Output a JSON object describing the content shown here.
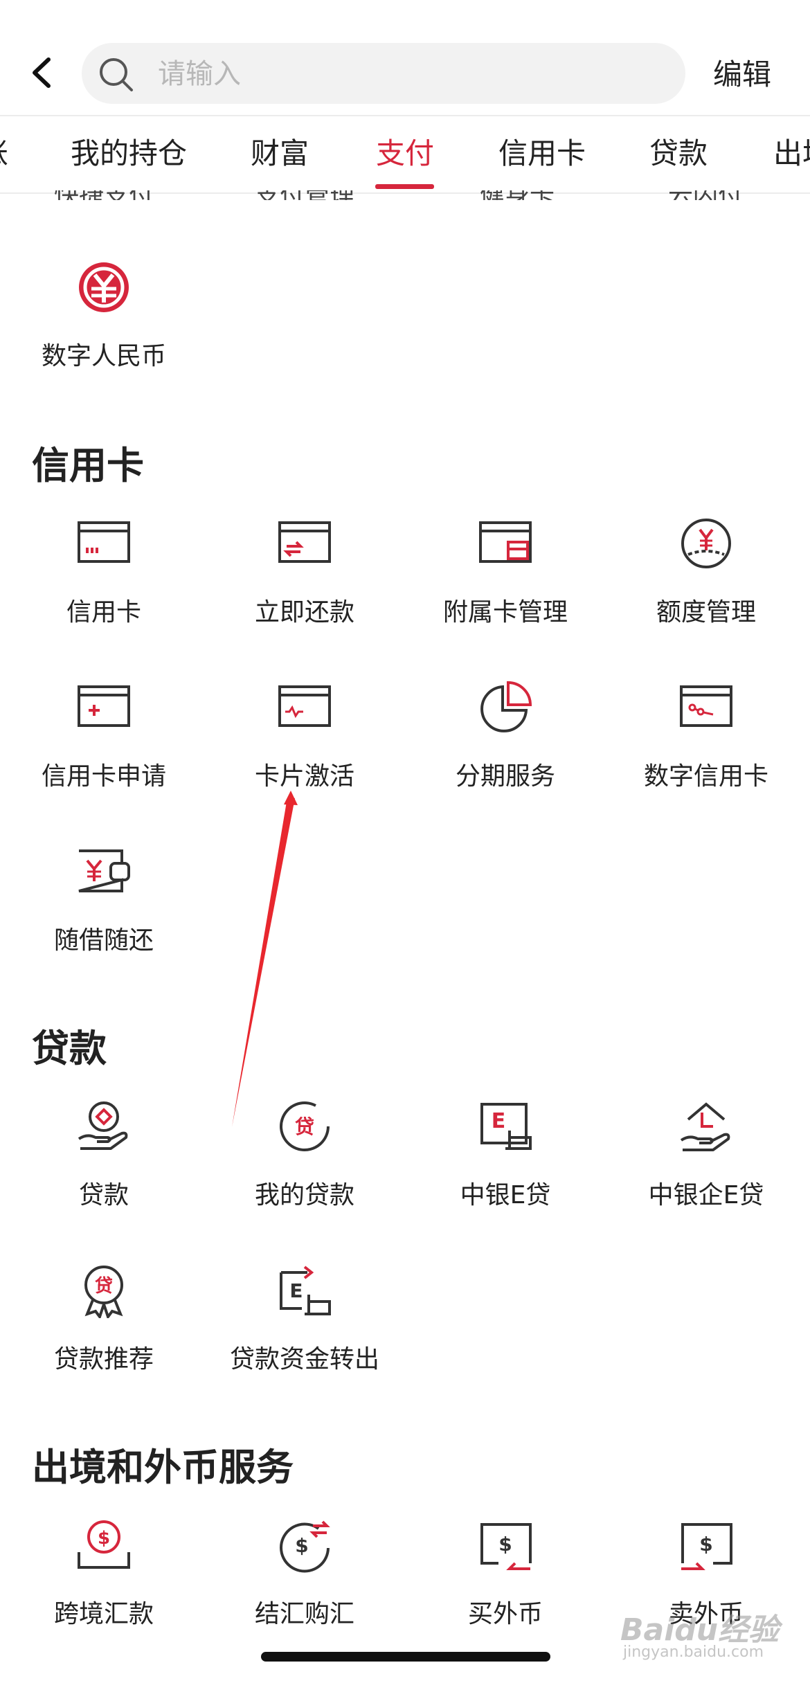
{
  "search": {
    "placeholder": "请输入"
  },
  "header": {
    "edit_label": "编辑"
  },
  "tabs": [
    "账",
    "我的持仓",
    "财富",
    "支付",
    "信用卡",
    "贷款",
    "出境"
  ],
  "active_tab": "支付",
  "partial_row": [
    "快捷支付",
    "支付管理",
    "健身卡",
    "云闪付"
  ],
  "sections": {
    "digital": {
      "items": [
        {
          "label": "数字人民币",
          "icon": "digital-rmb-icon"
        }
      ]
    },
    "credit": {
      "title": "信用卡",
      "items": [
        {
          "label": "信用卡",
          "icon": "credit-card-icon"
        },
        {
          "label": "立即还款",
          "icon": "repay-card-icon"
        },
        {
          "label": "附属卡管理",
          "icon": "supplementary-card-icon"
        },
        {
          "label": "额度管理",
          "icon": "credit-limit-icon"
        },
        {
          "label": "信用卡申请",
          "icon": "card-apply-icon"
        },
        {
          "label": "卡片激活",
          "icon": "card-activate-icon"
        },
        {
          "label": "分期服务",
          "icon": "installment-pie-icon"
        },
        {
          "label": "数字信用卡",
          "icon": "digital-card-icon"
        },
        {
          "label": "随借随还",
          "icon": "wallet-icon"
        }
      ]
    },
    "loan": {
      "title": "贷款",
      "items": [
        {
          "label": "贷款",
          "icon": "loan-hand-icon"
        },
        {
          "label": "我的贷款",
          "icon": "my-loan-icon"
        },
        {
          "label": "中银E贷",
          "icon": "e-loan-icon"
        },
        {
          "label": "中银企E贷",
          "icon": "enterprise-loan-icon"
        },
        {
          "label": "贷款推荐",
          "icon": "loan-badge-icon"
        },
        {
          "label": "贷款资金转出",
          "icon": "loan-transfer-icon"
        }
      ]
    },
    "fx": {
      "title": "出境和外币服务",
      "items": [
        {
          "label": "跨境汇款",
          "icon": "cross-border-remit-icon"
        },
        {
          "label": "结汇购汇",
          "icon": "exchange-icon"
        },
        {
          "label": "买外币",
          "icon": "buy-fx-icon"
        },
        {
          "label": "卖外币",
          "icon": "sell-fx-icon"
        }
      ]
    }
  },
  "watermark": {
    "text": "Baidu经验",
    "sub": "jingyan.baidu.com"
  },
  "colors": {
    "accent": "#d6263c",
    "stroke": "#333333"
  }
}
